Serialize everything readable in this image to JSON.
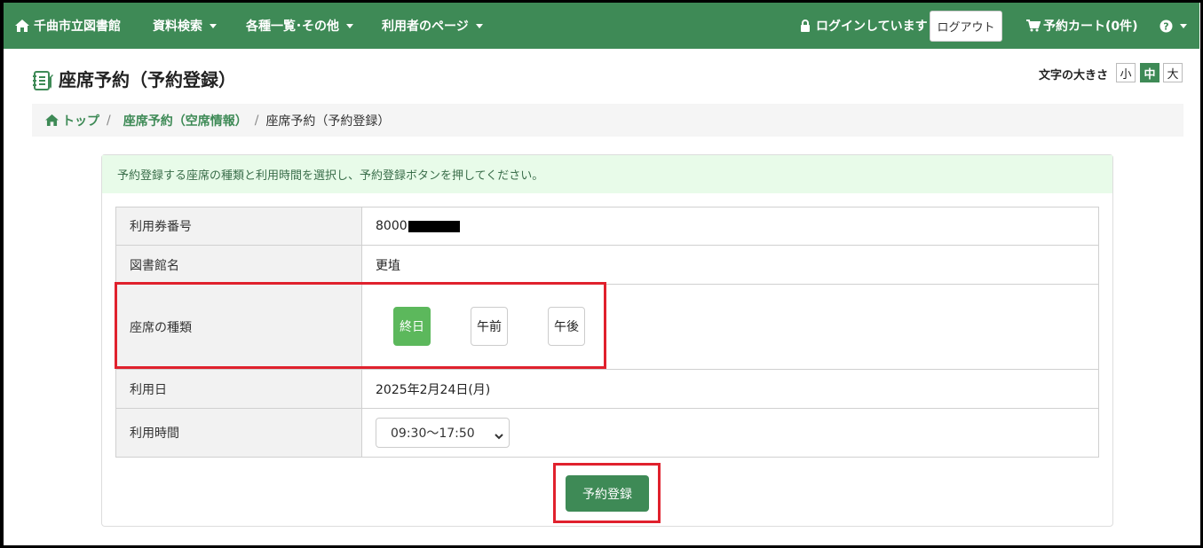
{
  "navbar": {
    "brand": "千曲市立図書館",
    "menus": [
      "資料検索",
      "各種一覧･その他",
      "利用者のページ"
    ],
    "login_status": "ログインしています",
    "logout_label": "ログアウト",
    "cart_label": "予約カート(0件)",
    "help_icon": "question-circle-icon"
  },
  "header": {
    "title": "座席予約（予約登録）",
    "font_size_label": "文字の大きさ",
    "font_sizes": [
      "小",
      "中",
      "大"
    ],
    "font_size_selected": "中"
  },
  "breadcrumb": {
    "top": "トップ",
    "parent": "座席予約（空席情報）",
    "current": "座席予約（予約登録）"
  },
  "form": {
    "instruction": "予約登録する座席の種類と利用時間を選択し、予約登録ボタンを押してください。",
    "rows": {
      "card_label": "利用券番号",
      "card_value": "8000",
      "library_label": "図書館名",
      "library_value": "更埴",
      "seat_label": "座席の種類",
      "date_label": "利用日",
      "date_value": "2025年2月24日(月)",
      "time_label": "利用時間",
      "time_value": "09:30～17:50"
    },
    "seat_options": [
      "終日",
      "午前",
      "午後"
    ],
    "seat_selected": "終日",
    "submit_label": "予約登録"
  },
  "colors": {
    "nav_bg": "#3e8a56",
    "active_seat": "#5cb85c",
    "highlight": "#e0212d",
    "alert_bg": "#e8fbe9"
  }
}
